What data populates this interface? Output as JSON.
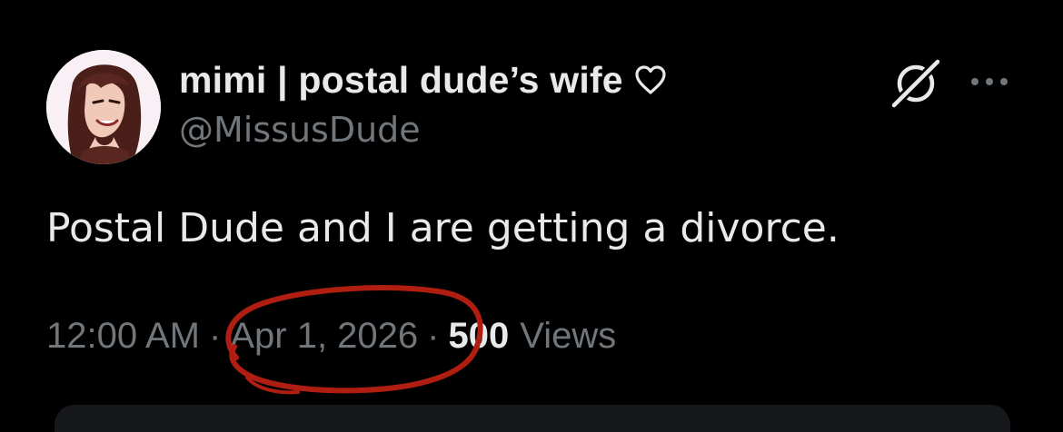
{
  "tweet": {
    "display_name": "mimi | postal dude’s wife",
    "handle": "@MissusDude",
    "text": "Postal Dude and I are getting a divorce.",
    "time": "12:00 AM",
    "separator": "·",
    "date": "Apr 1, 2026",
    "views_count": "500",
    "views_label": "Views"
  },
  "icons": {
    "name_badge": "heart-outline-icon",
    "grok": "grok-icon",
    "more": "more-horizontal-icon"
  },
  "colors": {
    "background": "#000000",
    "primary_text": "#e7e9ea",
    "secondary_text": "#71767b",
    "annotation": "#b01e12"
  }
}
